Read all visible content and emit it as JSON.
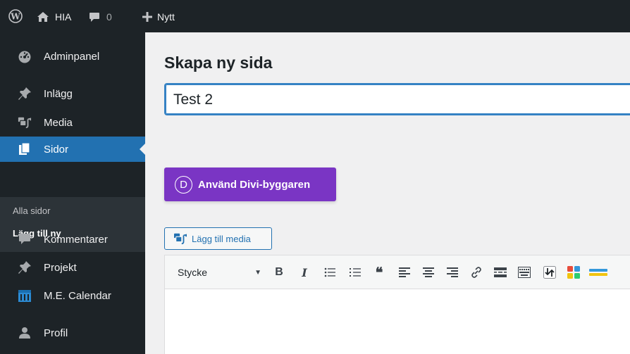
{
  "adminbar": {
    "site_name": "HIA",
    "comment_count": "0",
    "new_label": "Nytt",
    "icons": [
      "wordpress-logo-icon",
      "home-icon",
      "comment-bubble-icon",
      "plus-icon"
    ]
  },
  "sidebar": {
    "items": [
      {
        "label": "Adminpanel",
        "icon": "dashboard-icon"
      },
      {
        "label": "Inlägg",
        "icon": "pin-icon"
      },
      {
        "label": "Media",
        "icon": "media-icon"
      },
      {
        "label": "Sidor",
        "icon": "pages-icon",
        "active": true
      },
      {
        "label": "Kommentarer",
        "icon": "comment-icon"
      },
      {
        "label": "Projekt",
        "icon": "pin-icon"
      },
      {
        "label": "M.E. Calendar",
        "icon": "calendar-icon"
      },
      {
        "label": "Profil",
        "icon": "user-icon"
      }
    ],
    "submenu": [
      {
        "label": "Alla sidor"
      },
      {
        "label": "Lägg till ny",
        "current": true
      }
    ]
  },
  "main": {
    "page_title": "Skapa ny sida",
    "title_value": "Test 2",
    "divi_button": {
      "letter": "D",
      "label": "Använd Divi-byggaren"
    },
    "media_button": "Lägg till media",
    "editor": {
      "format_select": "Stycke",
      "toolbar_icons": [
        "bold-icon",
        "italic-icon",
        "bullet-list-icon",
        "numbered-list-icon",
        "blockquote-icon",
        "align-left-icon",
        "align-center-icon",
        "align-right-icon",
        "link-icon",
        "read-more-icon",
        "toolbar-toggle-icon",
        "divi-shortcode-icon",
        "divi-layout-icon",
        "divi-color-icon"
      ],
      "bold": "B",
      "italic": "I",
      "quote": "❝"
    }
  },
  "colors": {
    "adminbar_bg": "#1d2327",
    "sidebar_active": "#2271b1",
    "divi_purple": "#7a35c4",
    "input_focus": "#3582c4"
  }
}
